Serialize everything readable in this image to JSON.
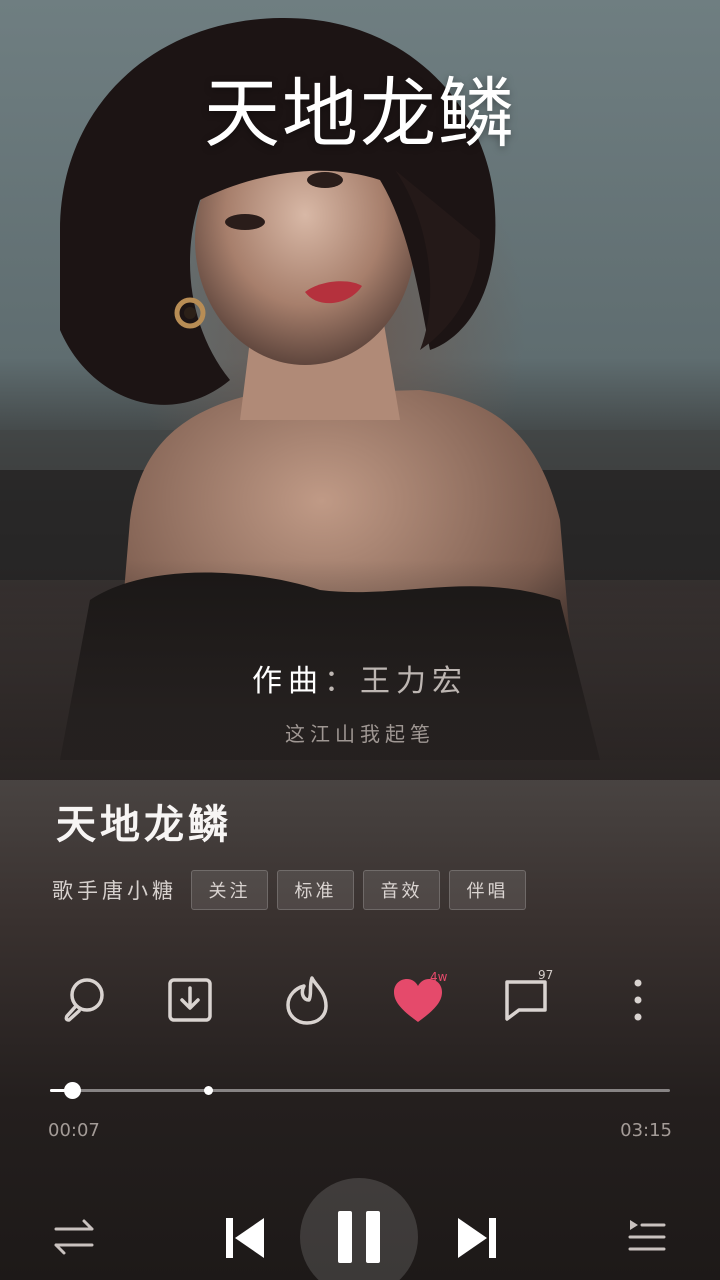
{
  "cover": {
    "title_overlay": "天地龙鳞"
  },
  "lyrics": {
    "current_label": "作曲",
    "current_separator": "：",
    "current_value": "王力宏",
    "next_line": "这江山我起笔"
  },
  "song": {
    "title": "天地龙鳞",
    "singer": "歌手唐小糖"
  },
  "chips": [
    {
      "label": "关注"
    },
    {
      "label": "标准"
    },
    {
      "label": "音效"
    },
    {
      "label": "伴唱"
    }
  ],
  "actions": {
    "search_icon": "search-icon",
    "download_icon": "download-icon",
    "flame_icon": "flame-icon",
    "like_icon": "heart-icon",
    "like_count": "4w",
    "comment_icon": "comment-icon",
    "comment_count": "97",
    "more_icon": "more-vertical-icon"
  },
  "progress": {
    "elapsed": "00:07",
    "duration": "03:15",
    "played_fraction": 0.036,
    "marker_fraction": 0.255
  },
  "controls": {
    "mode_icon": "shuffle-icon",
    "prev_icon": "previous-icon",
    "play_pause_icon": "pause-icon",
    "next_icon": "next-icon",
    "playlist_icon": "playlist-icon"
  },
  "colors": {
    "accent_heart": "#e54a6b",
    "text_primary": "#ffffff"
  }
}
